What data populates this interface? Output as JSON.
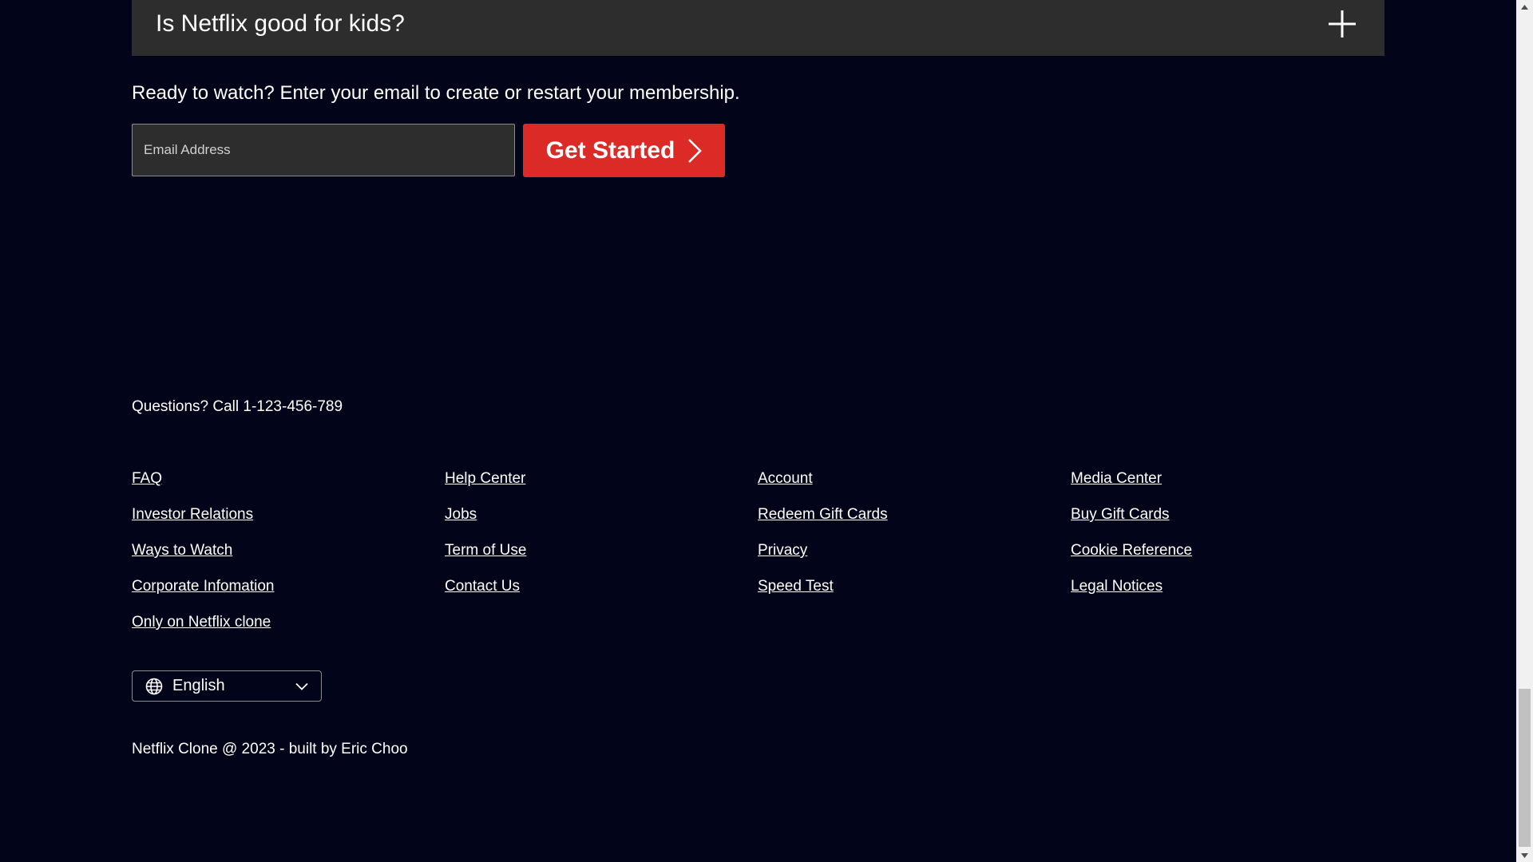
{
  "faq": {
    "question": "Is Netflix good for kids?"
  },
  "signup": {
    "prompt": "Ready to watch? Enter your email to create or restart your membership.",
    "email_placeholder": "Email Address",
    "button_label": "Get Started"
  },
  "footer": {
    "questions": "Questions? Call 1-123-456-789",
    "columns": [
      [
        "FAQ",
        "Investor Relations",
        "Ways to Watch",
        "Corporate Infomation",
        "Only on Netflix clone"
      ],
      [
        "Help Center",
        "Jobs",
        "Term of Use",
        "Contact Us"
      ],
      [
        "Account",
        "Redeem Gift Cards",
        "Privacy",
        "Speed Test"
      ],
      [
        "Media Center",
        "Buy Gift Cards",
        "Cookie Reference",
        "Legal Notices"
      ]
    ],
    "language": "English",
    "copyright": "Netflix Clone @ 2023 - built by Eric Choo"
  },
  "icons": {
    "faq_toggle": "plus-icon",
    "button_arrow": "chevron-right-icon",
    "language": "globe-icon",
    "dropdown": "chevron-down-icon"
  },
  "colors": {
    "background": "#02051a",
    "faq_background": "#2d2d2d",
    "accent": "#dc2a26",
    "text": "#ffffff"
  }
}
